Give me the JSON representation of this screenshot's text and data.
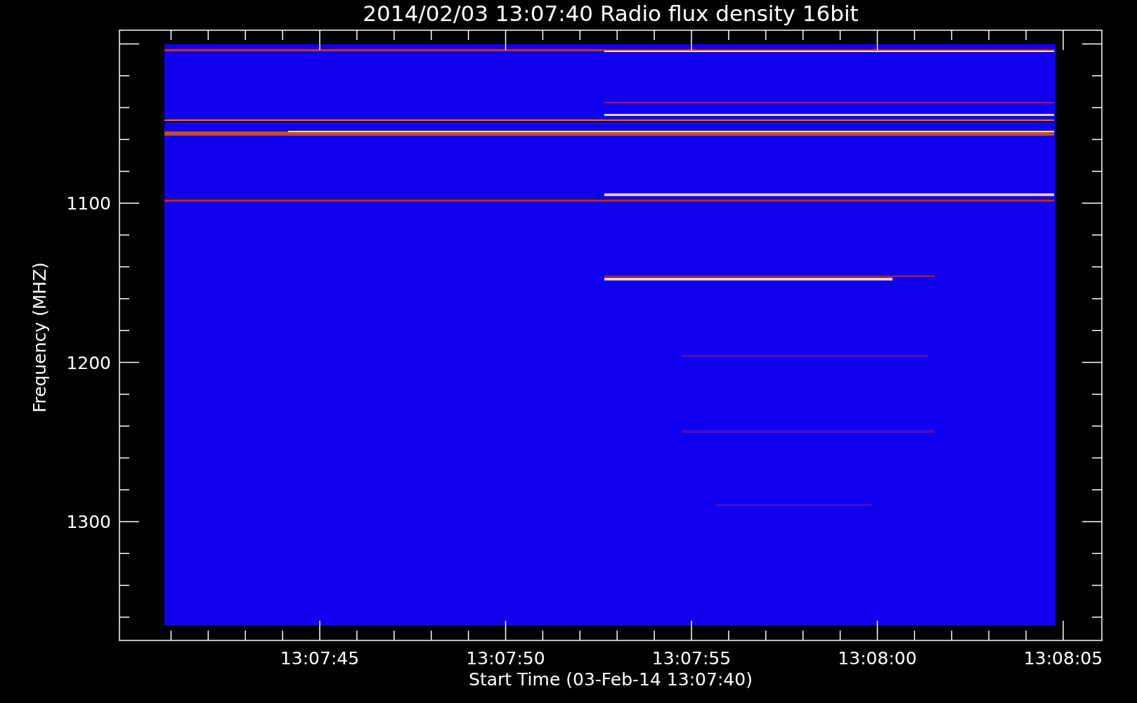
{
  "title": "2014/02/03 13:07:40 Radio flux density 16bit",
  "y_axis": {
    "label": "Frequency (MHZ)",
    "tick_labels": [
      "1100",
      "1200",
      "1300"
    ]
  },
  "x_axis": {
    "label": "Start Time (03-Feb-14 13:07:40)",
    "tick_labels": [
      "13:07:45",
      "13:07:50",
      "13:07:55",
      "13:08:00",
      "13:08:05"
    ]
  }
}
